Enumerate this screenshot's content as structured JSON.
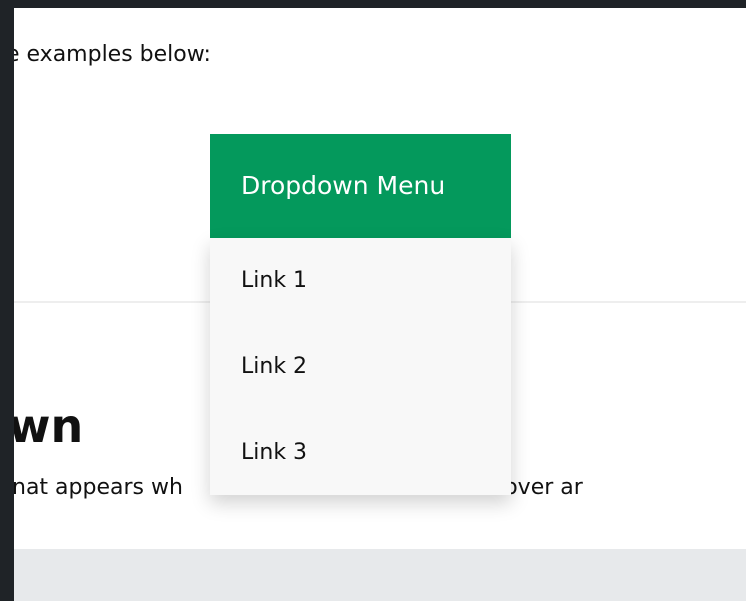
{
  "page": {
    "intro_text": "e examples below:",
    "heading_fragment": "wn",
    "description_fragment_left": "nat appears wh",
    "description_fragment_right": "ne mouse over ar"
  },
  "dropdown": {
    "button_label": "Dropdown Menu",
    "links": [
      "Link 1",
      "Link 2",
      "Link 3"
    ]
  },
  "colors": {
    "accent": "#04995c",
    "menu_background": "#f8f8f8",
    "bottom_band": "#e7e9eb",
    "frame": "#1f2327"
  }
}
